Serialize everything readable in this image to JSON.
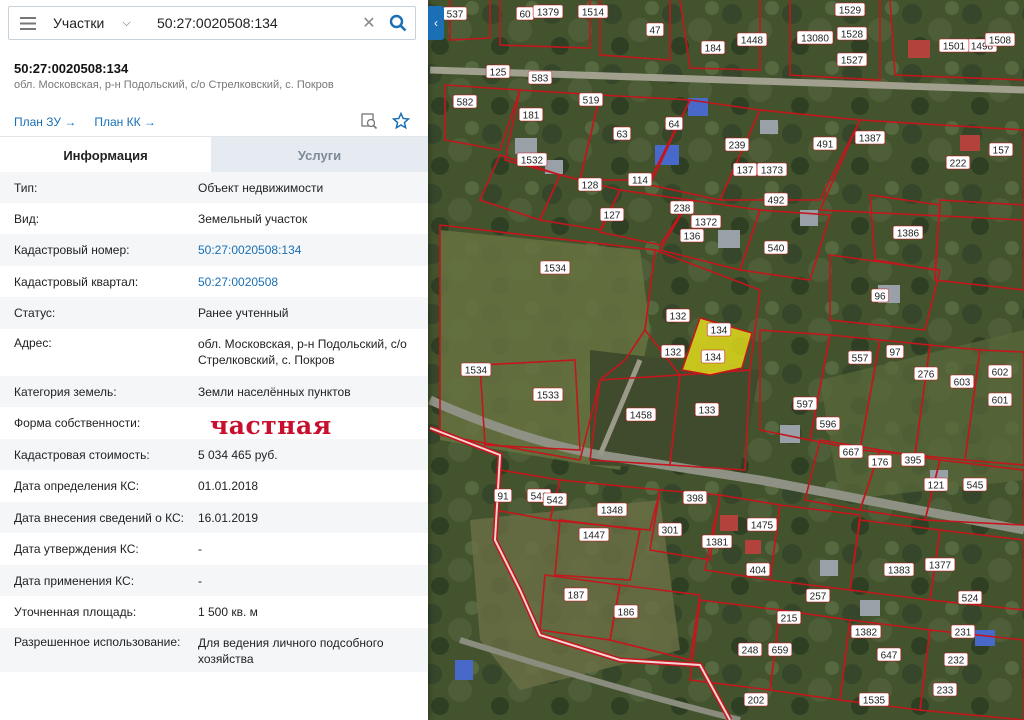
{
  "search": {
    "layer_select": "Участки",
    "value": "50:27:0020508:134"
  },
  "parcel": {
    "title": "50:27:0020508:134",
    "subtitle": "обл. Московская, р-н Подольский, с/о Стрелковский, с. Покров",
    "links": [
      "План ЗУ →",
      "План КК →"
    ]
  },
  "tabs": [
    "Информация",
    "Услуги"
  ],
  "info": [
    {
      "k": "Тип:",
      "v": "Объект недвижимости"
    },
    {
      "k": "Вид:",
      "v": "Земельный участок"
    },
    {
      "k": "Кадастровый номер:",
      "v": "50:27:0020508:134",
      "link": true
    },
    {
      "k": "Кадастровый квартал:",
      "v": "50:27:0020508",
      "link": true
    },
    {
      "k": "Статус:",
      "v": "Ранее учтенный"
    },
    {
      "k": "Адрес:",
      "v": "обл. Московская, р-н Подольский, с/о Стрелковский, с. Покров"
    },
    {
      "k": "Категория земель:",
      "v": "Земли населённых пунктов"
    },
    {
      "k": "Форма собственности:",
      "v": ""
    },
    {
      "k": "Кадастровая стоимость:",
      "v": "5 034 465 руб."
    },
    {
      "k": "Дата определения КС:",
      "v": "01.01.2018"
    },
    {
      "k": "Дата внесения сведений о КС:",
      "v": "16.01.2019"
    },
    {
      "k": "Дата утверждения КС:",
      "v": "-"
    },
    {
      "k": "Дата применения КС:",
      "v": "-"
    },
    {
      "k": "Уточненная площадь:",
      "v": "1 500 кв. м"
    },
    {
      "k": "Разрешенное использование:",
      "v": "Для ведения личного подсобного хозяйства"
    }
  ],
  "stamp": "частная",
  "map": {
    "parcel_labels": [
      "537",
      "60",
      "1379",
      "1514",
      "1529",
      "1528",
      "1527",
      "1498",
      "1501",
      "1508",
      "47",
      "184",
      "1448",
      "13080",
      "582",
      "125",
      "583",
      "519",
      "63",
      "64",
      "181",
      "1532",
      "128",
      "114",
      "127",
      "238",
      "239",
      "137",
      "1373",
      "491",
      "1387",
      "222",
      "157",
      "1372",
      "136",
      "492",
      "540",
      "1386",
      "1534",
      "132",
      "134",
      "134",
      "132",
      "96",
      "1534",
      "1533",
      "1458",
      "133",
      "557",
      "97",
      "276",
      "603",
      "602",
      "601",
      "597",
      "596",
      "667",
      "176",
      "395",
      "121",
      "545",
      "91",
      "541",
      "542",
      "1348",
      "398",
      "301",
      "1381",
      "1475",
      "1447",
      "187",
      "186",
      "404",
      "215",
      "257",
      "1382",
      "1383",
      "1377",
      "524",
      "248",
      "659",
      "231",
      "232",
      "647",
      "202",
      "233",
      "1535"
    ],
    "colors": {
      "parcel_border": "#c4161c",
      "selected_fill": "#e8e21a",
      "accent": "#1a6fb5"
    }
  }
}
